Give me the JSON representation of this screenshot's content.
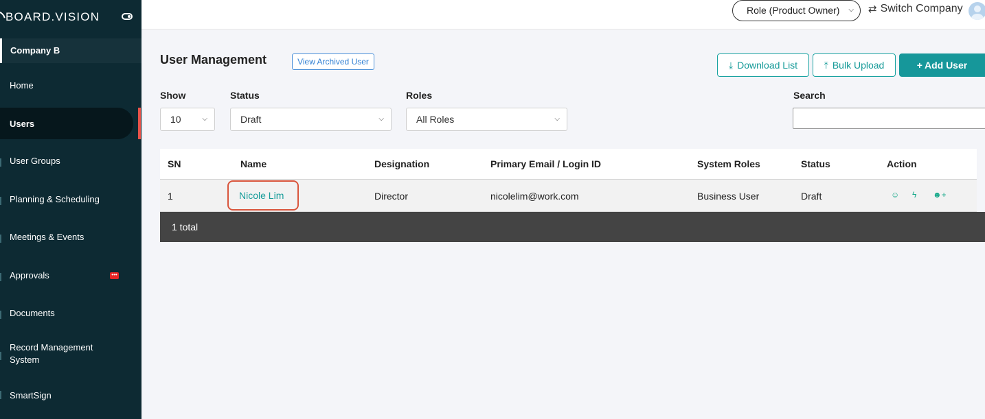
{
  "sidebar": {
    "brand": "BOARD.VISION",
    "company": "Company B",
    "items": [
      {
        "label": "Home"
      },
      {
        "label": "Users"
      },
      {
        "label": "User Groups"
      },
      {
        "label": "Planning & Scheduling"
      },
      {
        "label": "Meetings & Events"
      },
      {
        "label": "Approvals",
        "badge": "•••"
      },
      {
        "label": "Documents"
      },
      {
        "label": "Record Management System"
      },
      {
        "label": "SmartSign"
      }
    ]
  },
  "topbar": {
    "role": "Role (Product Owner)",
    "switch_company": "Switch Company"
  },
  "main": {
    "title": "User Management",
    "view_archived": "View Archived User",
    "download": "Download List",
    "bulk_upload": "Bulk Upload",
    "add_user": "Add User",
    "filters": {
      "show_label": "Show",
      "show_value": "10",
      "status_label": "Status",
      "status_value": "Draft",
      "roles_label": "Roles",
      "roles_value": "All Roles",
      "search_label": "Search",
      "search_value": ""
    },
    "table": {
      "columns": [
        "SN",
        "Name",
        "Designation",
        "Primary Email / Login ID",
        "System Roles",
        "Status",
        "Action"
      ],
      "rows": [
        {
          "sn": "1",
          "name": "Nicole Lim",
          "designation": "Director",
          "email": "nicolelim@work.com",
          "roles": "Business User",
          "status": "Draft"
        }
      ],
      "footer": "1 total"
    }
  },
  "colors": {
    "sidebar_bg": "#0d2a33",
    "accent": "#16979a",
    "highlight": "#d9553c"
  },
  "icons": {
    "toggle": "toggle-icon",
    "download": "download-icon",
    "upload": "upload-icon",
    "plus": "plus-icon",
    "swap": "swap-icon",
    "group": "group-icon",
    "bolt": "bolt-icon",
    "user_add": "user-add-icon"
  }
}
